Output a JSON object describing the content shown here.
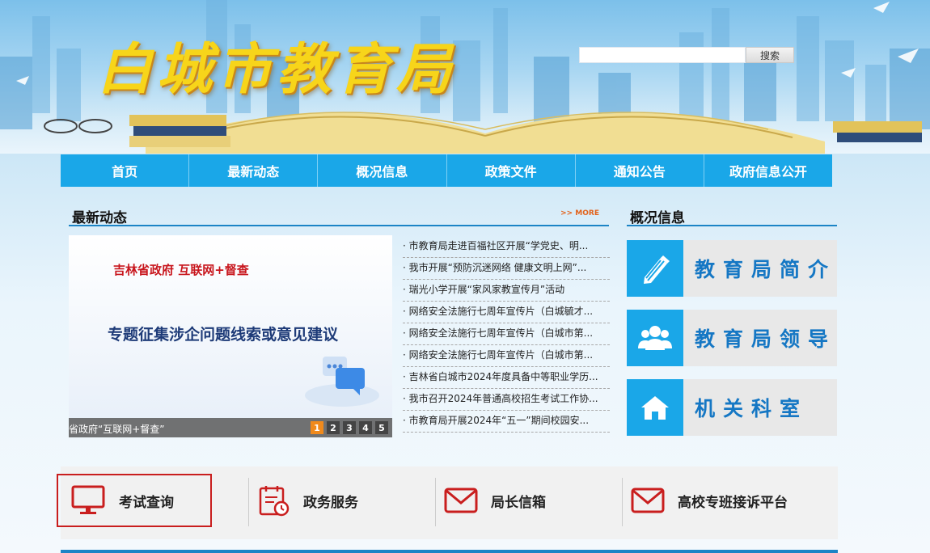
{
  "header": {
    "logo_text": "白城市教育局",
    "search": {
      "placeholder": "",
      "value": "",
      "button_label": "搜索"
    }
  },
  "nav": {
    "items": [
      {
        "label": "首页"
      },
      {
        "label": "最新动态"
      },
      {
        "label": "概况信息"
      },
      {
        "label": "政策文件"
      },
      {
        "label": "通知公告"
      },
      {
        "label": "政府信息公开"
      }
    ]
  },
  "news_section": {
    "title": "最新动态",
    "more_label": ">> MORE",
    "slide": {
      "subtitle": "吉林省政府 互联网+督查",
      "headline": "专题征集涉企问题线索或意见建议",
      "caption": "省政府“互联网+督查”",
      "pages": [
        "1",
        "2",
        "3",
        "4",
        "5"
      ],
      "active_page": "1"
    },
    "items": [
      "· 市教育局走进百福社区开展“学党史、明...",
      "· 我市开展“预防沉迷网络 健康文明上网”...",
      "· 瑞光小学开展“家风家教宣传月”活动",
      "· 网络安全法施行七周年宣传片（白城毓才...",
      "· 网络安全法施行七周年宣传片（白城市第...",
      "· 网络安全法施行七周年宣传片（白城市第...",
      "· 吉林省白城市2024年度具备中等职业学历...",
      "· 我市召开2024年普通高校招生考试工作协...",
      "· 市教育局开展2024年“五一”期间校园安..."
    ]
  },
  "overview_section": {
    "title": "概况信息",
    "blocks": [
      {
        "label": "教育局简介",
        "icon": "pencil-icon"
      },
      {
        "label": "教育局领导",
        "icon": "people-icon"
      },
      {
        "label": "机关科室",
        "icon": "house-icon"
      }
    ]
  },
  "services": [
    {
      "label": "考试查询",
      "icon": "monitor-icon"
    },
    {
      "label": "政务服务",
      "icon": "calendar-clock-icon"
    },
    {
      "label": "局长信箱",
      "icon": "envelope-icon"
    },
    {
      "label": "高校专班接诉平台",
      "icon": "envelope-icon"
    }
  ],
  "colors": {
    "nav_blue": "#1aa7e8",
    "accent_red": "#c91e1e",
    "title_blue": "#1577c4",
    "logo_yellow": "#f7d51a"
  }
}
